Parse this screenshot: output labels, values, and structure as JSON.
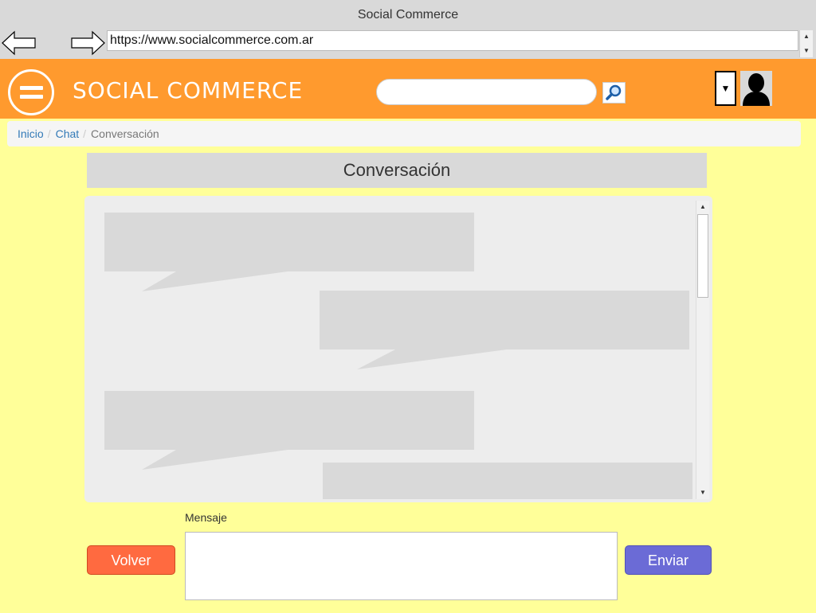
{
  "browser": {
    "window_title": "Social Commerce",
    "url": "https://www.socialcommerce.com.ar"
  },
  "header": {
    "brand": "SOCIAL COMMERCE",
    "search_placeholder": "",
    "dropdown_glyph": "▼",
    "accent_color": "#ff9a2e"
  },
  "breadcrumb": {
    "items": [
      "Inicio",
      "Chat"
    ],
    "separator": "/",
    "current": "Conversación"
  },
  "conversation": {
    "title": "Conversación",
    "messages": [
      {
        "side": "left"
      },
      {
        "side": "right"
      },
      {
        "side": "left"
      },
      {
        "side": "right"
      }
    ]
  },
  "composer": {
    "label": "Mensaje",
    "value": "",
    "back_label": "Volver",
    "send_label": "Enviar"
  },
  "colors": {
    "page_background": "#ffff99",
    "back_button": "#ff6a40",
    "send_button": "#6b6bd6"
  }
}
